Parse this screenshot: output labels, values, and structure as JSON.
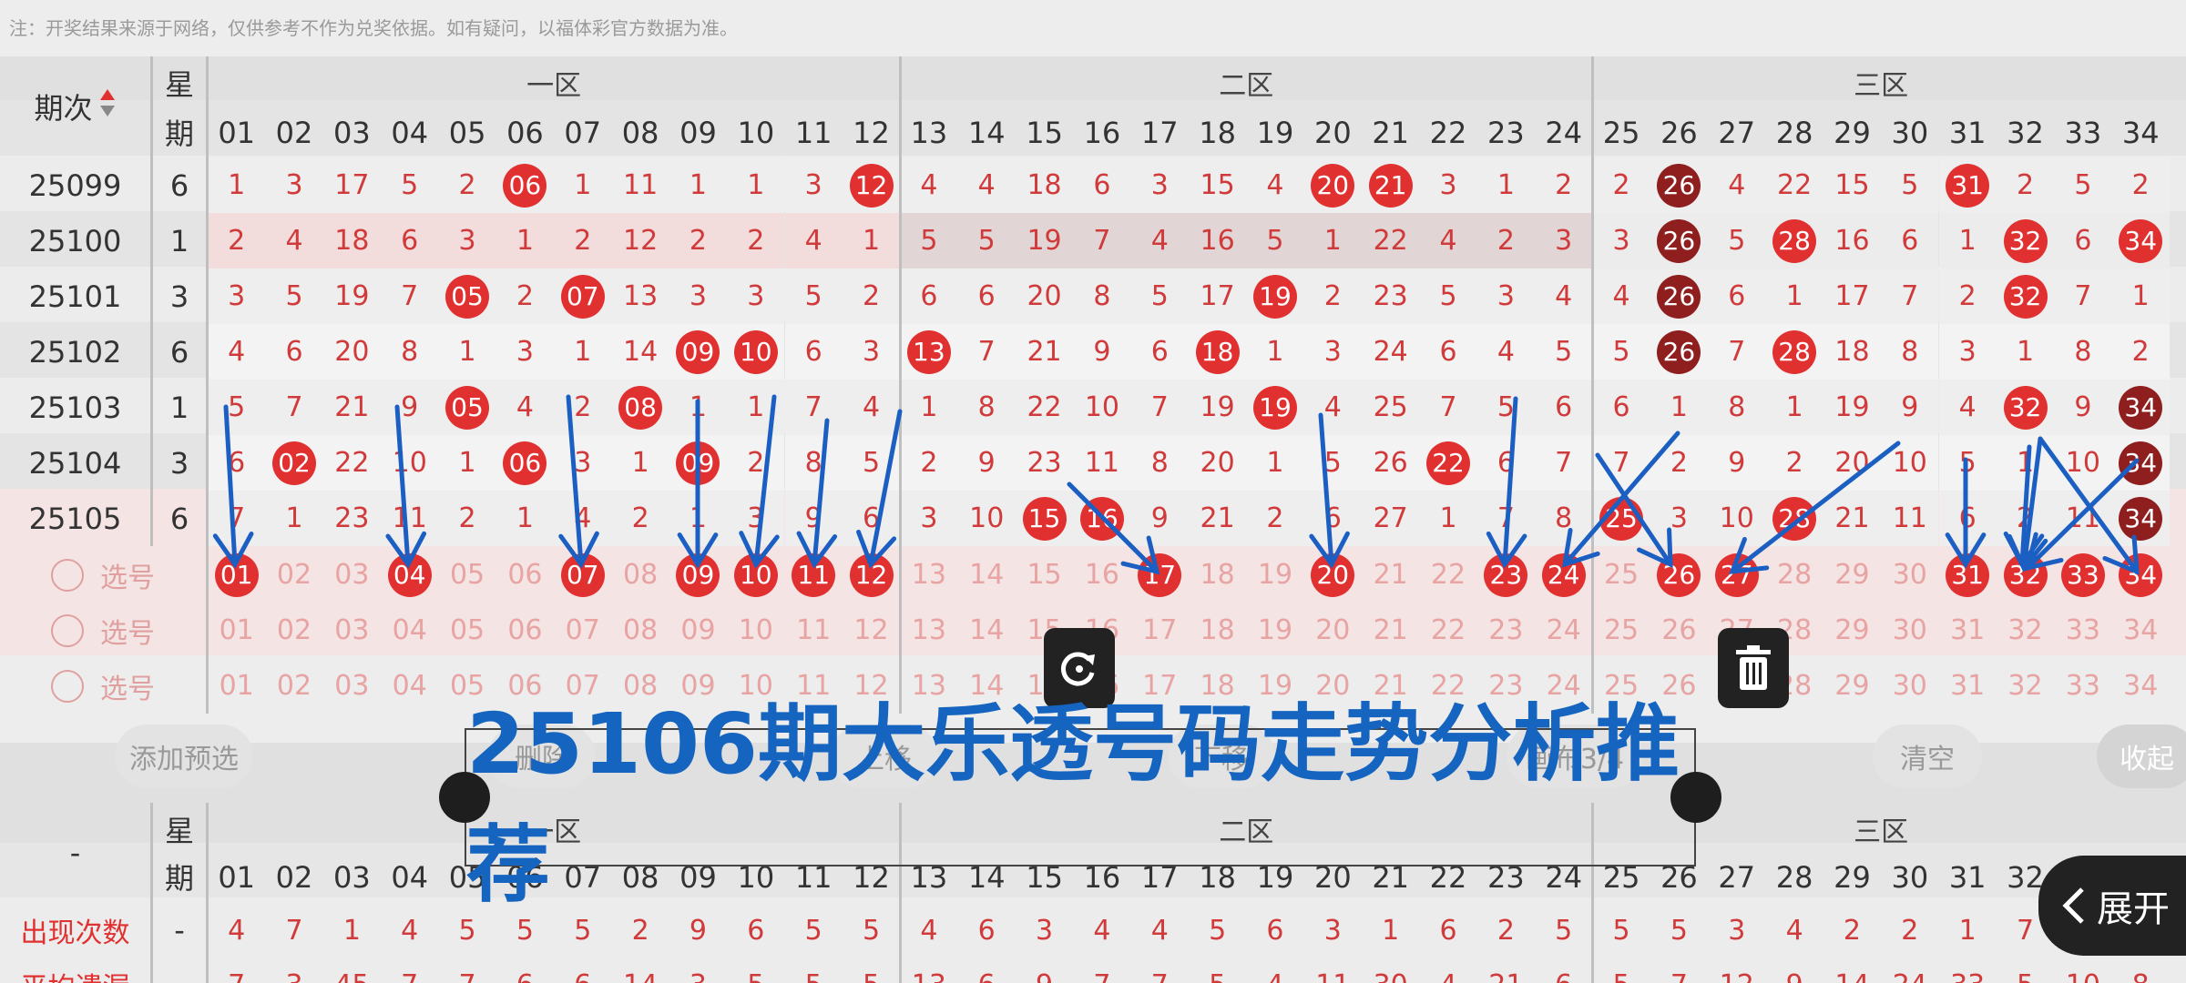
{
  "notice": "注：开奖结果来源于网络，仅供参考不作为兑奖依据。如有疑问，以福体彩官方数据为准。",
  "header": {
    "period_label": "期次",
    "week_top": "星",
    "week_bottom": "期",
    "zones": [
      "一区",
      "二区",
      "三区"
    ],
    "numbers": [
      "01",
      "02",
      "03",
      "04",
      "05",
      "06",
      "07",
      "08",
      "09",
      "10",
      "11",
      "12",
      "13",
      "14",
      "15",
      "16",
      "17",
      "18",
      "19",
      "20",
      "21",
      "22",
      "23",
      "24",
      "25",
      "26",
      "27",
      "28",
      "29",
      "30",
      "31",
      "32",
      "33",
      "34"
    ]
  },
  "rows": [
    {
      "period": "25099",
      "week": "6",
      "cells": [
        "1",
        "3",
        "17",
        "5",
        "2",
        "06",
        "1",
        "11",
        "1",
        "1",
        "3",
        "12",
        "4",
        "4",
        "18",
        "6",
        "3",
        "15",
        "4",
        "20",
        "21",
        "3",
        "1",
        "2",
        "2",
        "26",
        "4",
        "22",
        "15",
        "5",
        "31",
        "2",
        "5",
        "2"
      ]
    },
    {
      "period": "25100",
      "week": "1",
      "cells": [
        "2",
        "4",
        "18",
        "6",
        "3",
        "1",
        "2",
        "12",
        "2",
        "2",
        "4",
        "1",
        "5",
        "5",
        "19",
        "7",
        "4",
        "16",
        "5",
        "1",
        "22",
        "4",
        "2",
        "3",
        "3",
        "26",
        "5",
        "28",
        "16",
        "6",
        "1",
        "32",
        "6",
        "34"
      ]
    },
    {
      "period": "25101",
      "week": "3",
      "cells": [
        "3",
        "5",
        "19",
        "7",
        "05",
        "2",
        "07",
        "13",
        "3",
        "3",
        "5",
        "2",
        "6",
        "6",
        "20",
        "8",
        "5",
        "17",
        "19",
        "2",
        "23",
        "5",
        "3",
        "4",
        "4",
        "26",
        "6",
        "1",
        "17",
        "7",
        "2",
        "32",
        "7",
        "1"
      ]
    },
    {
      "period": "25102",
      "week": "6",
      "cells": [
        "4",
        "6",
        "20",
        "8",
        "1",
        "3",
        "1",
        "14",
        "09",
        "10",
        "6",
        "3",
        "13",
        "7",
        "21",
        "9",
        "6",
        "18",
        "1",
        "3",
        "24",
        "6",
        "4",
        "5",
        "5",
        "26",
        "7",
        "28",
        "18",
        "8",
        "3",
        "1",
        "8",
        "2"
      ]
    },
    {
      "period": "25103",
      "week": "1",
      "cells": [
        "5",
        "7",
        "21",
        "9",
        "05",
        "4",
        "2",
        "08",
        "1",
        "1",
        "7",
        "4",
        "1",
        "8",
        "22",
        "10",
        "7",
        "19",
        "19",
        "4",
        "25",
        "7",
        "5",
        "6",
        "6",
        "1",
        "8",
        "1",
        "19",
        "9",
        "4",
        "32",
        "9",
        "34"
      ]
    },
    {
      "period": "25104",
      "week": "3",
      "cells": [
        "6",
        "02",
        "22",
        "10",
        "1",
        "06",
        "3",
        "1",
        "09",
        "2",
        "8",
        "5",
        "2",
        "9",
        "23",
        "11",
        "8",
        "20",
        "1",
        "5",
        "26",
        "22",
        "6",
        "7",
        "7",
        "2",
        "9",
        "2",
        "20",
        "10",
        "5",
        "1",
        "10",
        "34"
      ]
    },
    {
      "period": "25105",
      "week": "6",
      "cells": [
        "7",
        "1",
        "23",
        "11",
        "2",
        "1",
        "4",
        "2",
        "1",
        "3",
        "9",
        "6",
        "3",
        "10",
        "15",
        "16",
        "9",
        "21",
        "2",
        "6",
        "27",
        "1",
        "7",
        "8",
        "25",
        "3",
        "10",
        "28",
        "21",
        "11",
        "6",
        "2",
        "11",
        "34"
      ]
    }
  ],
  "pick": {
    "label": "选号",
    "selected": [
      "01",
      "04",
      "07",
      "09",
      "10",
      "11",
      "12",
      "17",
      "20",
      "23",
      "24",
      "26",
      "27",
      "31",
      "32",
      "33",
      "34"
    ]
  },
  "buttons": {
    "add": "添加预选",
    "delete": "删除",
    "up": "上移",
    "down": "下移",
    "canvas": "画布3/4",
    "clear": "清空",
    "collapse": "收起"
  },
  "banner": {
    "text": "25106期大乐透号码走势分析推荐"
  },
  "stats": {
    "dash": "-",
    "row1": {
      "label": "出现次数",
      "week": "-",
      "values": [
        "4",
        "7",
        "1",
        "4",
        "5",
        "5",
        "5",
        "2",
        "9",
        "6",
        "5",
        "5",
        "4",
        "6",
        "3",
        "4",
        "4",
        "5",
        "6",
        "3",
        "1",
        "6",
        "2",
        "5",
        "5",
        "5",
        "3",
        "4",
        "2",
        "2",
        "1",
        "7",
        "",
        ""
      ]
    },
    "row2": {
      "label": "平均遗漏",
      "week": "-",
      "values": [
        "7",
        "3",
        "45",
        "7",
        "7",
        "6",
        "6",
        "14",
        "3",
        "5",
        "5",
        "5",
        "13",
        "6",
        "9",
        "7",
        "7",
        "5",
        "4",
        "11",
        "30",
        "4",
        "21",
        "6",
        "5",
        "7",
        "12",
        "9",
        "14",
        "24",
        "33",
        "5",
        "10",
        "8"
      ]
    }
  },
  "expand": {
    "label": "展开"
  },
  "colors": {
    "accent_red": "#e13030",
    "dark_red": "#8f1e1e",
    "arrow_blue": "#1c5fc2",
    "banner_blue": "#1565c0"
  }
}
